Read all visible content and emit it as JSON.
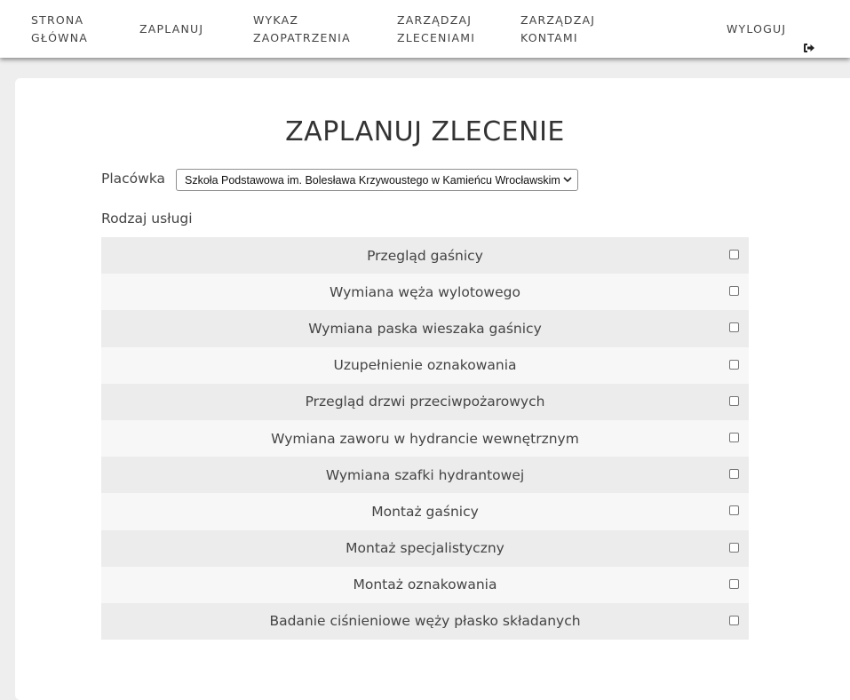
{
  "nav": {
    "home": "STRONA\nGŁÓWNA",
    "plan": "ZAPLANUJ",
    "supply": "WYKAZ\nZAOPATRZENIA",
    "orders": "ZARZĄDZAJ\nZLECENIAMI",
    "accounts": "ZARZĄDZAJ\nKONTAMI",
    "logout": "WYLOGUJ",
    "logout_icon": "sign-out-icon"
  },
  "main": {
    "title": "ZAPLANUJ ZLECENIE",
    "facility_label": "Placówka",
    "facility_value": "Szkoła Podstawowa im. Bolesława Krzywoustego w Kamieńcu Wrocławskim",
    "service_label": "Rodzaj usługi",
    "services": [
      {
        "name": "Przegląd gaśnicy",
        "checked": false
      },
      {
        "name": "Wymiana węża wylotowego",
        "checked": false
      },
      {
        "name": "Wymiana paska wieszaka gaśnicy",
        "checked": false
      },
      {
        "name": "Uzupełnienie oznakowania",
        "checked": false
      },
      {
        "name": "Przegląd drzwi przeciwpożarowych",
        "checked": false
      },
      {
        "name": "Wymiana zaworu w hydrancie wewnętrznym",
        "checked": false
      },
      {
        "name": "Wymiana szafki hydrantowej",
        "checked": false
      },
      {
        "name": "Montaż gaśnicy",
        "checked": false
      },
      {
        "name": "Montaż specjalistyczny",
        "checked": false
      },
      {
        "name": "Montaż oznakowania",
        "checked": false
      },
      {
        "name": "Badanie ciśnieniowe węży płasko składanych",
        "checked": false
      }
    ]
  },
  "colors": {
    "page_background": "#eeeeee",
    "card_background": "#ffffff",
    "row_odd": "#ececec",
    "row_even": "#f7f7f7",
    "text": "#444444"
  }
}
